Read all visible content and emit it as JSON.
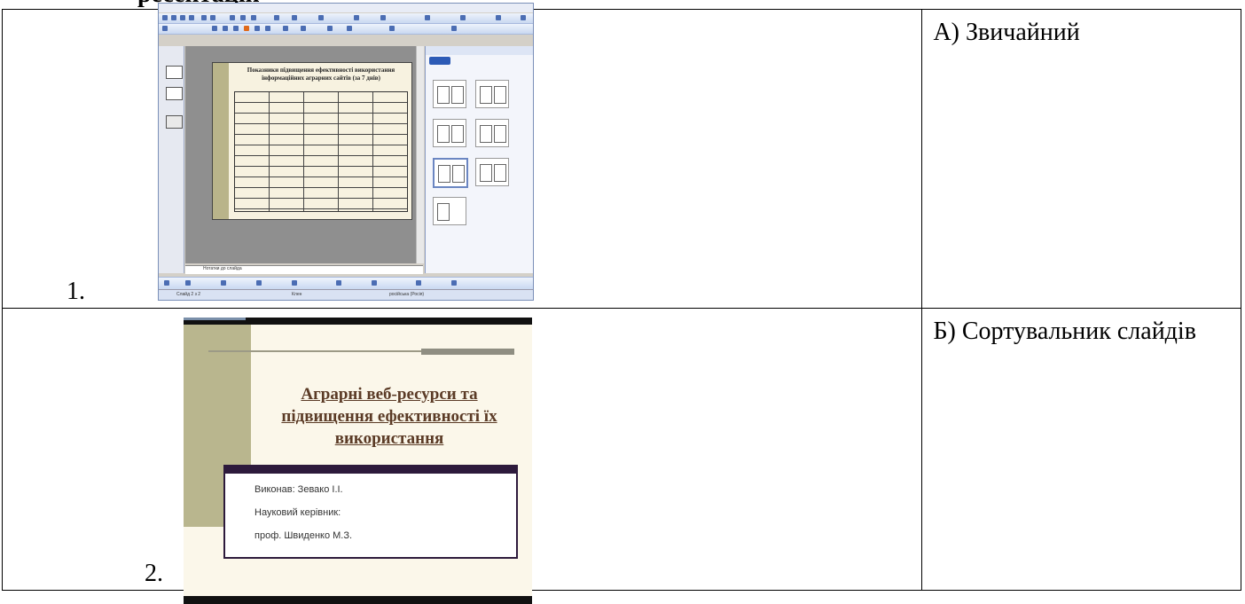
{
  "heading_fragment": "ресентацій",
  "rows": [
    {
      "number": "1.",
      "answer": "А) Звичайний",
      "screenshot": {
        "slide_title": "Показники підвищення ефективності використання інформаційних аграрних сайтів (за 7 днів)",
        "notes_placeholder": "Нотатки до слайда",
        "status_left": "Слайд 2 з 2",
        "status_mid": "Клен",
        "status_right": "російська (Росія)"
      }
    },
    {
      "number": "2.",
      "answer": "Б) Сортувальник слайдів",
      "screenshot": {
        "title": "Аграрні веб-ресурси та підвищення ефективності їх використання",
        "lines": [
          "Виконав: Зевако І.І.",
          "Науковий керівник:",
          "проф. Швиденко М.З."
        ]
      }
    }
  ]
}
